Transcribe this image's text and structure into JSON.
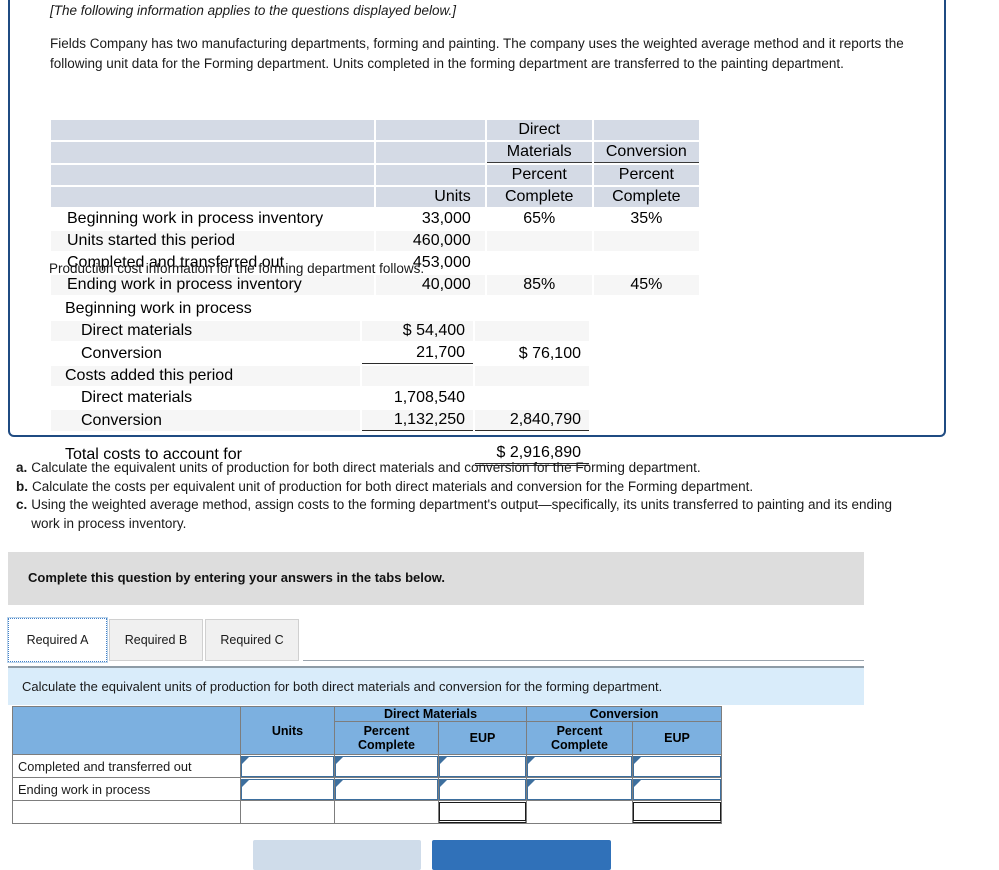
{
  "intro": {
    "applies_note": "[The following information applies to the questions displayed below.]",
    "paragraph": "Fields Company has two manufacturing departments, forming and painting. The company uses the weighted average method and it reports the following unit data for the Forming department. Units completed in the forming department are transferred to the painting department.",
    "cost_note": "Production cost information for the forming department follows."
  },
  "units_table": {
    "headers": {
      "group_direct_materials_line1": "Direct",
      "group_direct_materials_line2": "Materials",
      "group_conversion": "Conversion",
      "units": "Units",
      "percent_line1": "Percent",
      "percent_line2": "Complete"
    },
    "rows": [
      {
        "label": "Beginning work in process inventory",
        "units": "33,000",
        "dm_pct": "65%",
        "conv_pct": "35%"
      },
      {
        "label": "Units started this period",
        "units": "460,000",
        "dm_pct": "",
        "conv_pct": ""
      },
      {
        "label": "Completed and transferred out",
        "units": "453,000",
        "dm_pct": "",
        "conv_pct": ""
      },
      {
        "label": "Ending work in process inventory",
        "units": "40,000",
        "dm_pct": "85%",
        "conv_pct": "45%"
      }
    ]
  },
  "cost_table": {
    "rows": [
      {
        "label": "Beginning work in process",
        "indent": 0,
        "col1": "",
        "col2": ""
      },
      {
        "label": "Direct materials",
        "indent": 1,
        "col1": "$ 54,400",
        "col2": ""
      },
      {
        "label": "Conversion",
        "indent": 1,
        "col1": "21,700",
        "col2": "$ 76,100"
      },
      {
        "label": "Costs added this period",
        "indent": 0,
        "col1": "",
        "col2": ""
      },
      {
        "label": "Direct materials",
        "indent": 1,
        "col1": "1,708,540",
        "col2": ""
      },
      {
        "label": "Conversion",
        "indent": 1,
        "col1": "1,132,250",
        "col2": "2,840,790"
      },
      {
        "label": "Total costs to account for",
        "indent": 0,
        "col1": "",
        "col2": "$ 2,916,890"
      }
    ]
  },
  "requirements": [
    {
      "letter": "a.",
      "text": "Calculate the equivalent units of production for both direct materials and conversion for the Forming department."
    },
    {
      "letter": "b.",
      "text": "Calculate the costs per equivalent unit of production for both direct materials and conversion for the Forming department."
    },
    {
      "letter": "c.",
      "text": "Using the weighted average method, assign costs to the forming department's output—specifically, its units transferred to painting and its ending work in process inventory."
    }
  ],
  "complete_band": {
    "text": "Complete this question by entering your answers in the tabs below."
  },
  "tabs": [
    {
      "label": "Required A",
      "active": true
    },
    {
      "label": "Required B",
      "active": false
    },
    {
      "label": "Required C",
      "active": false
    }
  ],
  "req_band": {
    "text": "Calculate the equivalent units of production for both direct materials and conversion for the forming department."
  },
  "answer_grid": {
    "headers": {
      "units": "Units",
      "direct_materials": "Direct Materials",
      "conversion": "Conversion",
      "percent_complete_line1": "Percent",
      "percent_complete_line2": "Complete",
      "eup": "EUP"
    },
    "rows": [
      {
        "label": "Completed and transferred out",
        "units": "",
        "dm_pct": "",
        "dm_eup": "",
        "conv_pct": "",
        "conv_eup": ""
      },
      {
        "label": "Ending work in process",
        "units": "",
        "dm_pct": "",
        "dm_eup": "",
        "conv_pct": "",
        "conv_eup": ""
      },
      {
        "label": "",
        "units": "",
        "dm_pct": "",
        "dm_eup": "",
        "conv_pct": "",
        "conv_eup": ""
      }
    ]
  },
  "footer_buttons": {
    "prev_label": "",
    "next_label": ""
  },
  "colors": {
    "panel_border": "#1f4b82",
    "mono_header_bg": "#d4dae5",
    "grid_header_bg": "#7cb0e0",
    "instruction_gray": "#dddddd",
    "requirement_blue": "#d9ecfa",
    "next_button_blue": "#3071b9",
    "prev_button_blue": "#cfdcea"
  }
}
